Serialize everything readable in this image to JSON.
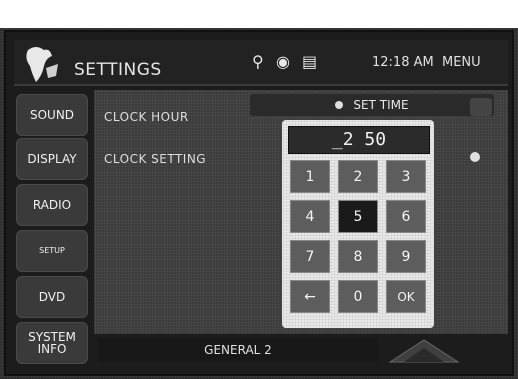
{
  "header": {
    "title": "SETTINGS",
    "clock": "12:18 AM",
    "menu_label": "MENU",
    "status_icons": [
      "usb-icon",
      "disc-icon",
      "device-icon"
    ]
  },
  "sidebar": {
    "items": [
      {
        "label": "SOUND"
      },
      {
        "label": "DISPLAY"
      },
      {
        "label": "RADIO"
      },
      {
        "label": "SETUP"
      },
      {
        "label": "DVD"
      },
      {
        "label_line1": "SYSTEM",
        "label_line2": "INFO"
      }
    ]
  },
  "settings": {
    "clock_hour_label": "CLOCK HOUR",
    "clock_setting_label": "CLOCK SETTING"
  },
  "set_time": {
    "title": "SET TIME",
    "display_value": "_2 50",
    "keys": [
      "1",
      "2",
      "3",
      "4",
      "5",
      "6",
      "7",
      "8",
      "9",
      "←",
      "0",
      "OK"
    ]
  },
  "footer": {
    "page_label": "GENERAL 2"
  },
  "colors": {
    "background": "#2f2f2f",
    "keypad": "#e9e9e9",
    "key": "#5d5d5d",
    "text": "#e6e6e6"
  }
}
